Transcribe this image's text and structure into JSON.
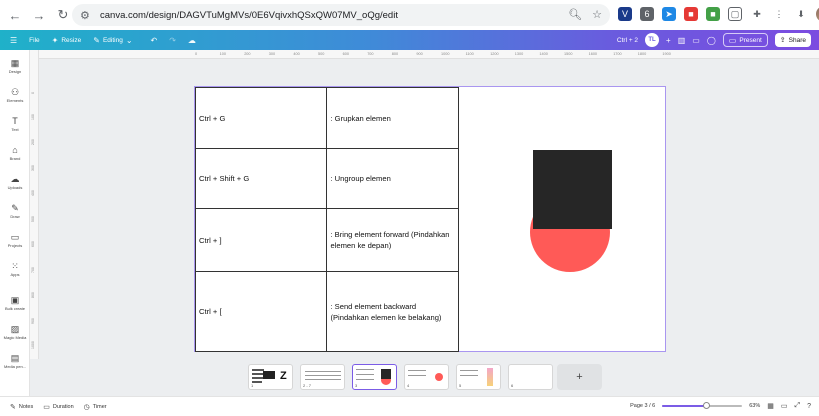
{
  "browser": {
    "url": "canva.com/design/DAGVTuMgMVs/0E6VqivxhQSxQW07MV_oQg/edit",
    "ext_badge": "6"
  },
  "canva_bar": {
    "file_label": "File",
    "resize_label": "Resize",
    "editing_label": "Editing",
    "shortcut_hint": "Ctrl + 2",
    "avatar_initials": "TL",
    "present_label": "Present",
    "share_label": "Share"
  },
  "sidebar": {
    "items": [
      {
        "label": "Design",
        "icon": "layout-icon"
      },
      {
        "label": "Elements",
        "icon": "shapes-icon"
      },
      {
        "label": "Text",
        "icon": "text-icon"
      },
      {
        "label": "Brand",
        "icon": "brand-icon"
      },
      {
        "label": "Uploads",
        "icon": "upload-icon"
      },
      {
        "label": "Draw",
        "icon": "pen-icon"
      },
      {
        "label": "Projects",
        "icon": "folder-icon"
      },
      {
        "label": "Apps",
        "icon": "apps-icon"
      },
      {
        "label": "Bulk create",
        "icon": "bulk-icon"
      },
      {
        "label": "Magic Media",
        "icon": "magic-icon"
      },
      {
        "label": "Media pen...",
        "icon": "media-icon"
      }
    ]
  },
  "ruler": {
    "h_ticks": [
      "0",
      "100",
      "200",
      "300",
      "400",
      "500",
      "600",
      "700",
      "800",
      "900",
      "1000",
      "1100",
      "1200",
      "1300",
      "1400",
      "1500",
      "1600",
      "1700",
      "1800",
      "1900"
    ],
    "v_ticks": [
      "0",
      "100",
      "200",
      "300",
      "400",
      "500",
      "600",
      "700",
      "800",
      "900",
      "1000"
    ]
  },
  "shortcuts_table": {
    "rows": [
      {
        "key": "Ctrl + G",
        "desc": ": Grupkan elemen"
      },
      {
        "key": "Ctrl + Shift + G",
        "desc": ": Ungroup elemen"
      },
      {
        "key": "Ctrl + ]",
        "desc": ": Bring element forward (Pindahkan elemen ke depan)"
      },
      {
        "key": "Ctrl + [",
        "desc": ": Send element backward (Pindahkan elemen ke belakang)"
      }
    ]
  },
  "shapes": {
    "circle_color": "#ff5a57",
    "square_color": "#262626"
  },
  "thumbnails": [
    {
      "num": "1"
    },
    {
      "num": "2 - 7"
    },
    {
      "num": "3",
      "active": true
    },
    {
      "num": "4"
    },
    {
      "num": "5"
    },
    {
      "num": "6"
    }
  ],
  "footer": {
    "notes_label": "Notes",
    "duration_label": "Duration",
    "timer_label": "Timer",
    "page_indicator": "Page 3 / 6",
    "zoom_percent": "63%",
    "zoom_fraction": 0.55
  }
}
